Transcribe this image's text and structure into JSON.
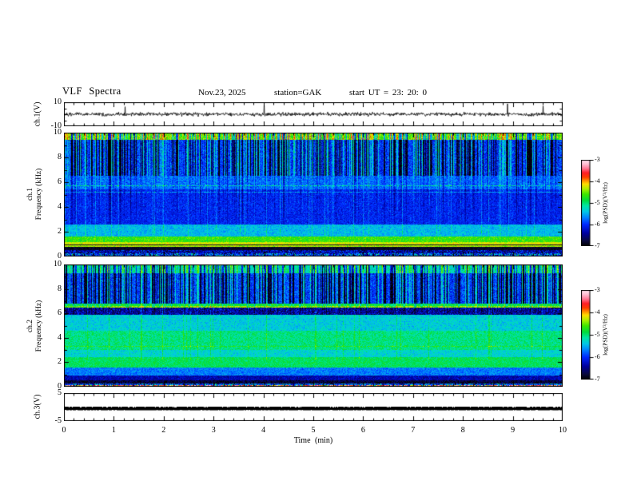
{
  "header": {
    "title": "VLF Spectra",
    "date": "Nov.23, 2025",
    "station": "station=GAK",
    "start_ut": "start UT =  23: 20: 0"
  },
  "x_axis": {
    "label": "Time (min)",
    "ticks": [
      0,
      1,
      2,
      3,
      4,
      5,
      6,
      7,
      8,
      9,
      10
    ],
    "range": [
      0,
      10
    ],
    "minor_step": 0.2
  },
  "panels": {
    "ch1_ts": {
      "ylabel": "ch.1(V)",
      "yticks": [
        10,
        -10
      ],
      "yrange": [
        -10,
        10
      ]
    },
    "spec1": {
      "ylabel_ch": "ch.1",
      "ylabel_freq": "Frequency (kHz)",
      "yticks": [
        10,
        8,
        6,
        4,
        2,
        0
      ],
      "yrange": [
        0,
        10
      ]
    },
    "spec2": {
      "ylabel_ch": "ch.2",
      "ylabel_freq": "Frequency (kHz)",
      "yticks": [
        10,
        8,
        6,
        4,
        2,
        0
      ],
      "yrange": [
        0,
        10
      ]
    },
    "ch3_ts": {
      "ylabel": "ch.3(V)",
      "yticks": [
        5,
        -5
      ],
      "yrange": [
        -5,
        5
      ]
    }
  },
  "colorbar": {
    "label": "log(PSD)(V²/Hz)",
    "ticks": [
      -3,
      -4,
      -5,
      -6,
      -7
    ],
    "range": [
      -7,
      -3
    ],
    "stops": [
      {
        "t": 0.0,
        "c": "#000000"
      },
      {
        "t": 0.06,
        "c": "#0a0a3c"
      },
      {
        "t": 0.15,
        "c": "#0000a0"
      },
      {
        "t": 0.25,
        "c": "#0028ff"
      },
      {
        "t": 0.33,
        "c": "#0082ff"
      },
      {
        "t": 0.4,
        "c": "#00c8e6"
      },
      {
        "t": 0.47,
        "c": "#00e6a0"
      },
      {
        "t": 0.53,
        "c": "#00dc3c"
      },
      {
        "t": 0.6,
        "c": "#3ce600"
      },
      {
        "t": 0.66,
        "c": "#aaf000"
      },
      {
        "t": 0.72,
        "c": "#ffdc00"
      },
      {
        "t": 0.76,
        "c": "#ff8c00"
      },
      {
        "t": 0.8,
        "c": "#ff3c00"
      },
      {
        "t": 0.85,
        "c": "#ff1e28"
      },
      {
        "t": 0.9,
        "c": "#ff7896"
      },
      {
        "t": 0.95,
        "c": "#ffbed2"
      },
      {
        "t": 1.0,
        "c": "#ffe6f0"
      }
    ]
  },
  "chart_data": [
    {
      "type": "line",
      "name": "ch.1 voltage waveform",
      "xlabel": "Time (min)",
      "xrange": [
        0,
        10
      ],
      "ylabel": "ch.1(V)",
      "yrange": [
        -10,
        10
      ],
      "baseline": 0,
      "noise_amp_v": 1.5,
      "description": "continuous broadband noise about 0 V with sparse impulsive spikes, mostly downward, reaching -8 V"
    },
    {
      "type": "heatmap",
      "name": "ch.1 spectrogram",
      "xrange": [
        0,
        10
      ],
      "yrange": [
        0,
        10
      ],
      "value_range": [
        -7,
        -3
      ],
      "bands": [
        [
          9.4,
          10.01,
          -4.55,
          0.45
        ],
        [
          6.5,
          9.4,
          -5.95,
          0.42
        ],
        [
          5.4,
          6.5,
          -5.75,
          0.35
        ],
        [
          2.6,
          5.4,
          -6.05,
          0.3
        ],
        [
          1.6,
          2.6,
          -5.45,
          0.3
        ],
        [
          1.15,
          1.6,
          -4.65,
          0.3
        ],
        [
          0.98,
          1.15,
          -4.25,
          0.25
        ],
        [
          0.88,
          0.98,
          -6.85,
          0.15
        ],
        [
          0.78,
          0.88,
          -4.35,
          0.3
        ],
        [
          0.5,
          0.78,
          -6.85,
          0.2
        ],
        [
          0.28,
          0.5,
          -6.35,
          0.7
        ],
        [
          0,
          0.28,
          -5.9,
          1.1
        ]
      ],
      "lines": [
        [
          5.72,
          0.6,
          0.05
        ],
        [
          5.18,
          0.5,
          0.05
        ]
      ],
      "streaks": {
        "black_prob": 0.08,
        "dark_prob": 0.24,
        "bright_prob": 0.2,
        "full": [
          6.5,
          10
        ],
        "fade": [
          2.6,
          6.5
        ],
        "fade_strength": [
          0.45,
          0.12
        ],
        "bright_floor": 1.6,
        "bright_persist": 0.35
      }
    },
    {
      "type": "heatmap",
      "name": "ch.2 spectrogram",
      "xrange": [
        0,
        10
      ],
      "yrange": [
        0,
        10
      ],
      "value_range": [
        -7,
        -3
      ],
      "bands": [
        [
          9.86,
          10.01,
          -5.0,
          0.3
        ],
        [
          9.3,
          9.86,
          -5.15,
          0.35
        ],
        [
          6.8,
          9.3,
          -5.9,
          0.42
        ],
        [
          6.45,
          6.8,
          -4.85,
          0.3
        ],
        [
          5.9,
          6.45,
          -6.4,
          0.6
        ],
        [
          4.6,
          5.9,
          -5.35,
          0.3
        ],
        [
          3.0,
          4.6,
          -5.05,
          0.28
        ],
        [
          2.4,
          3.0,
          -5.3,
          0.28
        ],
        [
          1.55,
          2.4,
          -4.95,
          0.25
        ],
        [
          0.9,
          1.55,
          -5.7,
          0.3
        ],
        [
          0.5,
          0.9,
          -6.35,
          0.3
        ],
        [
          0.28,
          0.5,
          -6.8,
          0.4
        ],
        [
          0,
          0.28,
          -5.9,
          1.0
        ]
      ],
      "lines": [
        [
          6.55,
          0.5,
          0.05
        ],
        [
          3.3,
          0.35,
          0.05
        ],
        [
          0.08,
          2.2,
          0.04
        ]
      ],
      "streaks": {
        "black_prob": 0.08,
        "dark_prob": 0.22,
        "bright_prob": 0.18,
        "full": [
          6.8,
          10
        ],
        "fade": [
          5.9,
          6.8
        ],
        "fade_strength": [
          0.5,
          0.2
        ],
        "bright_floor": 2.2,
        "bright_persist": 0.3
      }
    },
    {
      "type": "line",
      "name": "ch.3 voltage waveform",
      "xlabel": "Time (min)",
      "xrange": [
        0,
        10
      ],
      "ylabel": "ch.3(V)",
      "yrange": [
        -5,
        5
      ],
      "baseline": 0,
      "description": "thick flat saturated trace at 0 V across the full record"
    }
  ]
}
